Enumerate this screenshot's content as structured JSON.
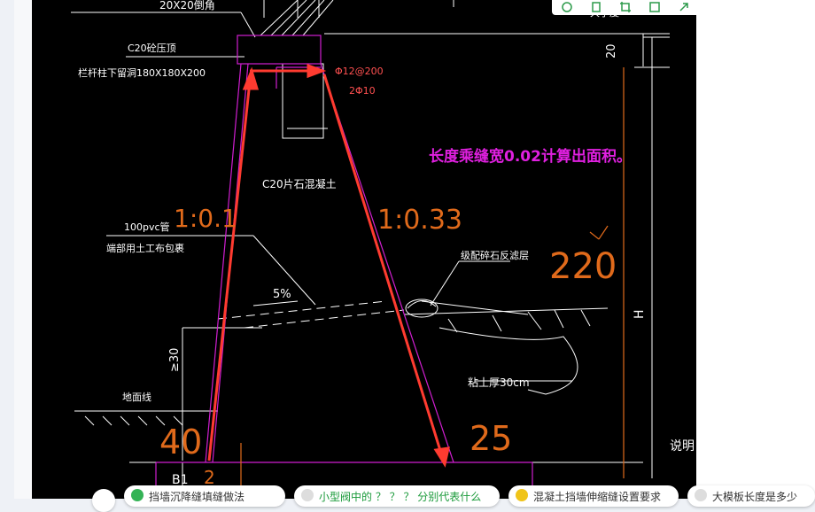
{
  "drawing": {
    "top_label": "20X20倒角",
    "c20_label": "C20砼压顶",
    "reserve_label": "栏杆柱下留洞180X180X200",
    "rebar_label": "Φ12@200",
    "rebar2_label": "2Φ10",
    "dim_20": "20",
    "annotation": "长度乘缝宽0.02计算出面积。",
    "rubble_label": "C20片石混凝土",
    "slope_left": "1:0.1",
    "slope_right": "1:0.33",
    "pvc_label": "100pvc管",
    "wrap_label": "端部用土工布包裹",
    "gravel_label": "级配碎石反滤层",
    "dim_220": "220",
    "percent_label": "5%",
    "h_label": "H",
    "ge30_label": "≥30",
    "clay_label": "粘土厚30cm",
    "ground_label": "地面线",
    "dim_40": "40",
    "dim_25": "25",
    "b1_label": "B1",
    "dim_2": "2",
    "explain_label": "说明",
    "top_right_label": "大于度"
  },
  "toolbar": {
    "buttons": [
      {
        "icon": "refresh-icon"
      },
      {
        "icon": "copy-icon"
      },
      {
        "icon": "crop-icon"
      },
      {
        "icon": "save-icon"
      },
      {
        "icon": "share-icon"
      },
      {
        "icon": "settings-icon"
      }
    ]
  },
  "chips": [
    {
      "label": "挡墙沉降缝填缝做法",
      "color": "#34b356"
    },
    {
      "label": "小型阀中的 ？ ？ ？ 分别代表什么",
      "color": "#dddddd"
    },
    {
      "label": "混凝土挡墙伸缩缝设置要求",
      "color": "#f0c419"
    },
    {
      "label": "大模板长度是多少",
      "color": "#dddddd"
    }
  ],
  "colors": {
    "cad_white": "#ffffff",
    "cad_magenta": "#d01ed0",
    "cad_orange": "#e06a1b",
    "arrow_red": "#ff3b30",
    "annotation_magenta": "#e020e0"
  }
}
